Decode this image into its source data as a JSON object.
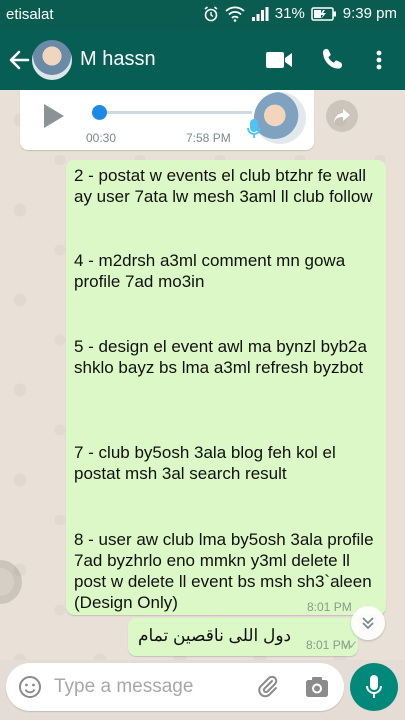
{
  "status_bar": {
    "carrier": "etisalat",
    "battery": "31%",
    "time": "9:39 pm"
  },
  "header": {
    "contact_name": "M hassn",
    "icons": [
      "back-arrow-icon",
      "avatar",
      "video-call-icon",
      "phone-icon",
      "more-vert-icon"
    ]
  },
  "voice_message": {
    "duration": "00:30",
    "time": "7:58 PM",
    "progress": 0.05,
    "icons": [
      "play-icon",
      "mic-icon",
      "share-icon"
    ]
  },
  "messages": [
    {
      "paragraphs": [
        "2 - postat w events el club btzhr fe wall ay user 7ata lw mesh 3aml ll club follow",
        "4 - m2drsh a3ml comment mn gowa profile 7ad mo3in",
        "5 - design el event awl ma bynzl byb2a shklo bayz bs lma a3ml refresh byzbot",
        "7 - club by5osh 3ala blog feh kol el postat msh 3al search result",
        "8 - user aw club lma by5osh 3ala profile 7ad byzhrlo eno mmkn y3ml delete ll post w delete ll event bs msh sh3`aleen (Design Only)"
      ],
      "time": "8:01 PM"
    },
    {
      "text": "دول اللى ناقصين تمام",
      "time": "8:01 PM"
    }
  ],
  "composer": {
    "placeholder": "Type a message",
    "icons": [
      "emoji-icon",
      "attach-icon",
      "camera-icon",
      "mic-icon"
    ]
  },
  "colors": {
    "header": "#075e54",
    "outgoing_bubble": "#dcf8c6",
    "accent": "#00897b"
  }
}
